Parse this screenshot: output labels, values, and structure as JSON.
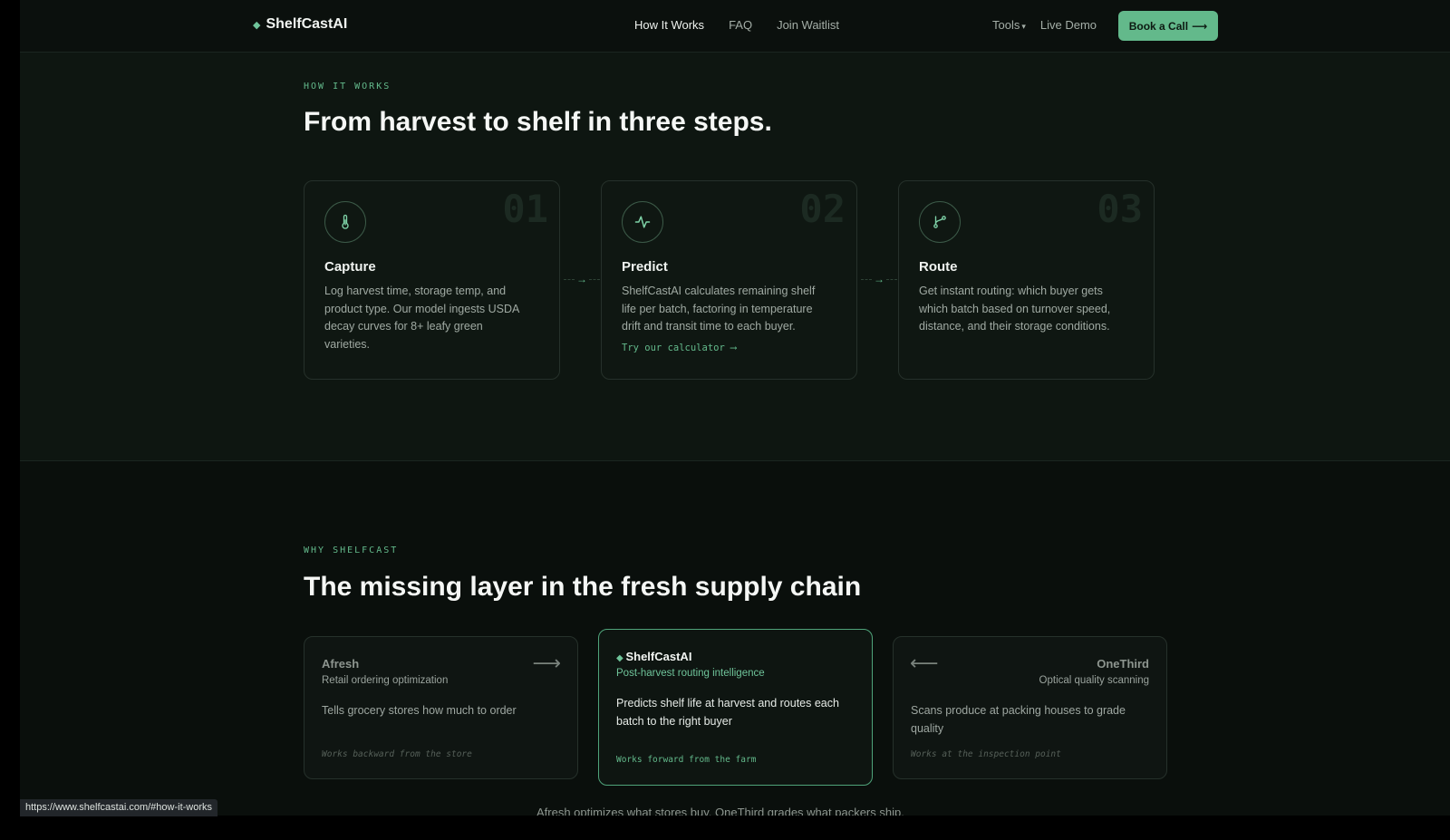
{
  "nav": {
    "brand": "ShelfCastAI",
    "links": [
      "How It Works",
      "FAQ",
      "Join Waitlist"
    ],
    "tools": "Tools",
    "live_demo": "Live Demo",
    "cta": "Book a Call",
    "cta_arrow": "⟶"
  },
  "how": {
    "eyebrow": "HOW IT WORKS",
    "title": "From harvest to shelf in three steps.",
    "steps": [
      {
        "num": "01",
        "title": "Capture",
        "desc": "Log harvest time, storage temp, and product type. Our model ingests USDA decay curves for 8+ leafy green varieties.",
        "icon": "thermometer-icon"
      },
      {
        "num": "02",
        "title": "Predict",
        "desc": "ShelfCastAI calculates remaining shelf life per batch, factoring in temperature drift and transit time to each buyer.",
        "link": "Try our calculator ⟶",
        "icon": "pulse-icon"
      },
      {
        "num": "03",
        "title": "Route",
        "desc": "Get instant routing: which buyer gets which batch based on turnover speed, distance, and their storage conditions.",
        "icon": "route-branch-icon"
      }
    ]
  },
  "why": {
    "eyebrow": "WHY SHELFCAST",
    "title": "The missing layer in the fresh supply chain",
    "cards": [
      {
        "title": "Afresh",
        "sub": "Retail ordering optimization",
        "desc": "Tells grocery stores how much to order",
        "foot": "Works backward from the store",
        "arrow": "⟶"
      },
      {
        "title": "ShelfCastAI",
        "sub": "Post-harvest routing intelligence",
        "desc": "Predicts shelf life at harvest and routes each batch to the right buyer",
        "foot": "Works forward from the farm"
      },
      {
        "title": "OneThird",
        "sub": "Optical quality scanning",
        "desc": "Scans produce at packing houses to grade quality",
        "foot": "Works at the inspection point",
        "arrow": "⟵"
      }
    ],
    "tail": "Afresh optimizes what stores buy. OneThird grades what packers ship."
  },
  "status_url": "https://www.shelfcastai.com/#how-it-works",
  "colors": {
    "accent": "#63b98b",
    "bg": "#0e1611"
  }
}
